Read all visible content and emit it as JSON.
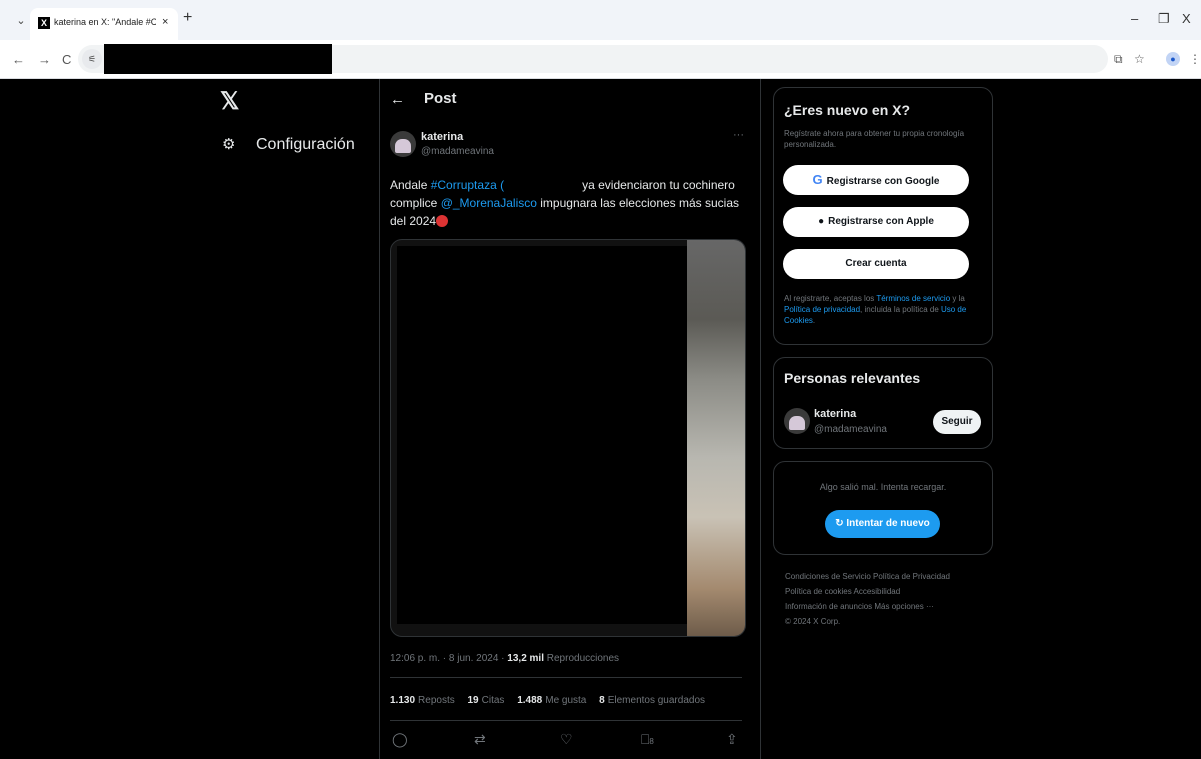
{
  "browser": {
    "tab_title": "katerina en X: \"Andale #Corrup",
    "favicon": "X",
    "new_tab": "+",
    "close": "×",
    "minimize": "–",
    "restore": "❐",
    "window_close": "X"
  },
  "nav": {
    "back": "←",
    "forward": "→",
    "reload": "C"
  },
  "left": {
    "logo": "𝕏",
    "settings_label": "Configuración"
  },
  "post": {
    "header": "Post",
    "author_name": "katerina",
    "author_handle": "@madameavina",
    "more": "···",
    "text_1": "Andale ",
    "hashtag": "#Corruptaza",
    "paren": " (",
    "text_2": "ya evidenciaron tu cochinero complice ",
    "mention": "@_MorenaJalisco",
    "text_3": " impugnara las elecciones más sucias del 2024",
    "time": "12:06 p. m. · 8 jun. 2024 · ",
    "views_count": "13,2 mil",
    "views_label": " Reproducciones",
    "reposts_count": "1.130",
    "reposts_label": "Reposts",
    "quotes_count": "19",
    "quotes_label": "Citas",
    "likes_count": "1.488",
    "likes_label": "Me gusta",
    "saves_count": "8",
    "saves_label": "Elementos guardados",
    "bookmark_count": "8"
  },
  "signup": {
    "title": "¿Eres nuevo en X?",
    "subtitle": "Regístrate ahora para obtener tu propia cronología personalizada.",
    "google": "Registrarse con Google",
    "apple": "Registrarse con Apple",
    "create": "Crear cuenta",
    "legal_1": "Al registrarte, aceptas los ",
    "terms": "Términos de servicio",
    "legal_2": " y la ",
    "privacy": "Política de privacidad",
    "legal_3": ", incluida la política de ",
    "cookies": "Uso de Cookies",
    "legal_4": "."
  },
  "relevant": {
    "title": "Personas relevantes",
    "name": "katerina",
    "handle": "@madameavina",
    "follow": "Seguir"
  },
  "error": {
    "message": "Algo salió mal. Intenta recargar.",
    "retry": "Intentar de nuevo"
  },
  "footer": {
    "l1": "Condiciones de Servicio   Política de Privacidad",
    "l2": "Política de cookies   Accesibilidad",
    "l3": "Información de anuncios   Más opciones ···",
    "l4": "© 2024 X Corp."
  }
}
